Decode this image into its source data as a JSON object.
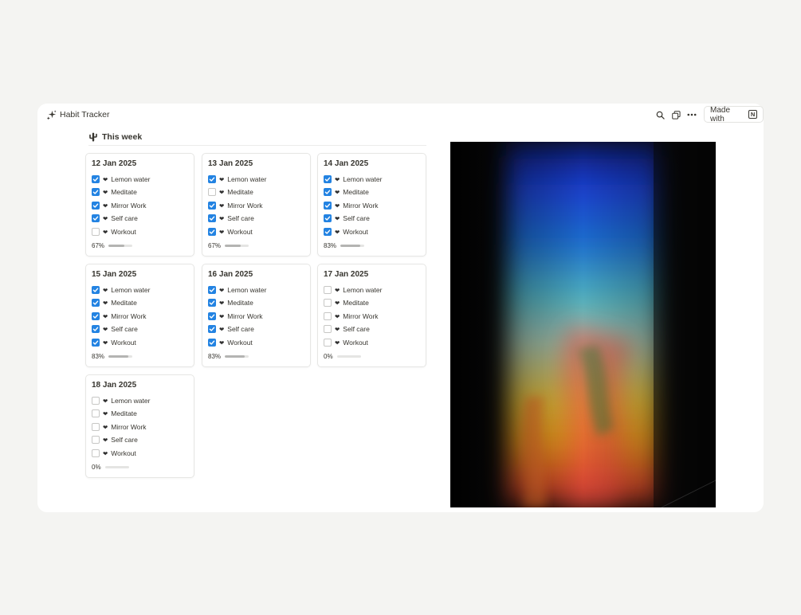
{
  "app": {
    "title": "Habit Tracker",
    "made_with": "Made with",
    "notion_glyph": "N"
  },
  "toolbar": {
    "icons": [
      "search-icon",
      "duplicate-icon",
      "more-icon"
    ]
  },
  "section": {
    "icon": "cactus-icon",
    "title": "This week"
  },
  "colors": {
    "checkbox_checked": "#2383e2",
    "background": "#f4f4f2",
    "text": "#37352f"
  },
  "cards": [
    {
      "date": "12 Jan 2025",
      "progress": "67%",
      "progress_value": 0.67,
      "habits": [
        {
          "label": "Lemon water",
          "checked": true
        },
        {
          "label": "Meditate",
          "checked": true
        },
        {
          "label": "Mirror Work",
          "checked": true
        },
        {
          "label": "Self care",
          "checked": true
        },
        {
          "label": "Workout",
          "checked": false
        }
      ]
    },
    {
      "date": "13 Jan 2025",
      "progress": "67%",
      "progress_value": 0.67,
      "habits": [
        {
          "label": "Lemon water",
          "checked": true
        },
        {
          "label": "Meditate",
          "checked": false
        },
        {
          "label": "Mirror Work",
          "checked": true
        },
        {
          "label": "Self care",
          "checked": true
        },
        {
          "label": "Workout",
          "checked": true
        }
      ]
    },
    {
      "date": "14 Jan 2025",
      "progress": "83%",
      "progress_value": 0.83,
      "habits": [
        {
          "label": "Lemon water",
          "checked": true
        },
        {
          "label": "Meditate",
          "checked": true
        },
        {
          "label": "Mirror Work",
          "checked": true
        },
        {
          "label": "Self care",
          "checked": true
        },
        {
          "label": "Workout",
          "checked": true
        }
      ]
    },
    {
      "date": "15 Jan 2025",
      "progress": "83%",
      "progress_value": 0.83,
      "habits": [
        {
          "label": "Lemon water",
          "checked": true
        },
        {
          "label": "Meditate",
          "checked": true
        },
        {
          "label": "Mirror Work",
          "checked": true
        },
        {
          "label": "Self care",
          "checked": true
        },
        {
          "label": "Workout",
          "checked": true
        }
      ]
    },
    {
      "date": "16 Jan 2025",
      "progress": "83%",
      "progress_value": 0.83,
      "habits": [
        {
          "label": "Lemon water",
          "checked": true
        },
        {
          "label": "Meditate",
          "checked": true
        },
        {
          "label": "Mirror Work",
          "checked": true
        },
        {
          "label": "Self care",
          "checked": true
        },
        {
          "label": "Workout",
          "checked": true
        }
      ]
    },
    {
      "date": "17 Jan 2025",
      "progress": "0%",
      "progress_value": 0,
      "habits": [
        {
          "label": "Lemon water",
          "checked": false
        },
        {
          "label": "Meditate",
          "checked": false
        },
        {
          "label": "Mirror Work",
          "checked": false
        },
        {
          "label": "Self care",
          "checked": false
        },
        {
          "label": "Workout",
          "checked": false
        }
      ]
    },
    {
      "date": "18 Jan 2025",
      "progress": "0%",
      "progress_value": 0,
      "habits": [
        {
          "label": "Lemon water",
          "checked": false
        },
        {
          "label": "Meditate",
          "checked": false
        },
        {
          "label": "Mirror Work",
          "checked": false
        },
        {
          "label": "Self care",
          "checked": false
        },
        {
          "label": "Workout",
          "checked": false
        }
      ]
    }
  ],
  "image": {
    "icon": "rainbow-light-photo"
  }
}
